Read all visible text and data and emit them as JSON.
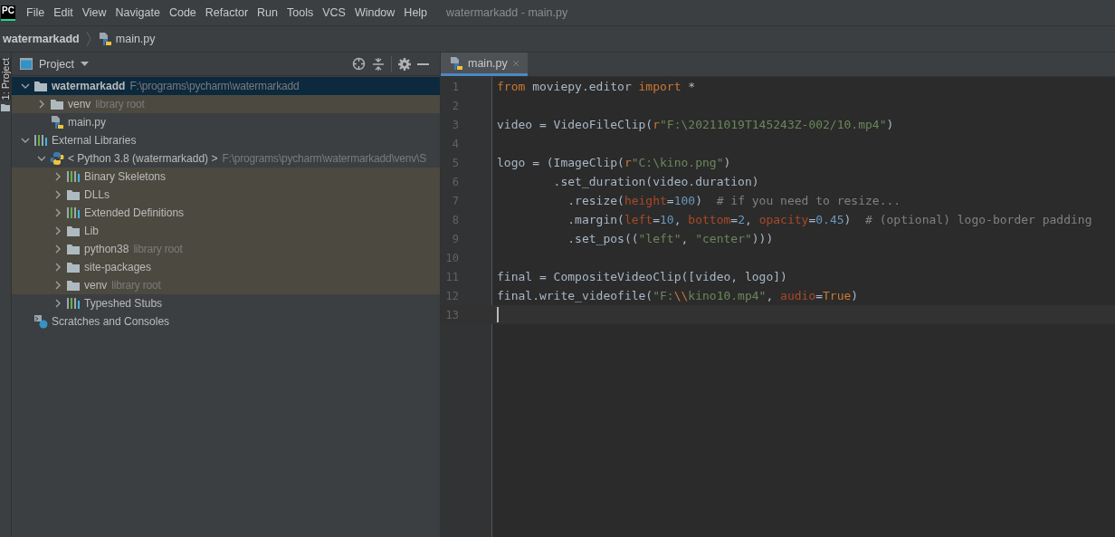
{
  "menu_bar": {
    "app_logo": "PC",
    "menu": [
      "File",
      "Edit",
      "View",
      "Navigate",
      "Code",
      "Refactor",
      "Run",
      "Tools",
      "VCS",
      "Window",
      "Help"
    ],
    "window_title": "watermarkadd - main.py"
  },
  "breadcrumb": [
    {
      "label": "watermarkadd",
      "kind": "project"
    },
    {
      "label": "main.py",
      "kind": "python_file"
    }
  ],
  "side_stripe": {
    "label": "1: Project"
  },
  "project_panel": {
    "title": "Project",
    "tree": [
      {
        "label": "watermarkadd",
        "kind": "project_folder",
        "hint": "F:\\programs\\pycharm\\watermarkadd",
        "expanded": true,
        "selected": true,
        "highlighted": false,
        "children": [
          {
            "label": "venv",
            "kind": "folder",
            "hint": "library root",
            "expanded": false,
            "selected": false,
            "highlighted": true
          },
          {
            "label": "main.py",
            "kind": "python_file",
            "selected": false,
            "highlighted": false
          }
        ]
      },
      {
        "label": "External Libraries",
        "kind": "library",
        "expanded": true,
        "selected": false,
        "highlighted": false,
        "children": [
          {
            "label": "< Python 3.8 (watermarkadd) >",
            "kind": "python",
            "hint": "F:\\programs\\pycharm\\watermarkadd\\venv\\S",
            "expanded": true,
            "selected": false,
            "highlighted": false,
            "children": [
              {
                "label": "Binary Skeletons",
                "kind": "library",
                "expanded": false,
                "selected": false,
                "highlighted": true
              },
              {
                "label": "DLLs",
                "kind": "folder",
                "expanded": false,
                "selected": false,
                "highlighted": true
              },
              {
                "label": "Extended Definitions",
                "kind": "library",
                "expanded": false,
                "selected": false,
                "highlighted": true
              },
              {
                "label": "Lib",
                "kind": "folder",
                "expanded": false,
                "selected": false,
                "highlighted": true
              },
              {
                "label": "python38",
                "kind": "folder",
                "hint": "library root",
                "expanded": false,
                "selected": false,
                "highlighted": true
              },
              {
                "label": "site-packages",
                "kind": "folder",
                "expanded": false,
                "selected": false,
                "highlighted": true
              },
              {
                "label": "venv",
                "kind": "folder",
                "hint": "library root",
                "expanded": false,
                "selected": false,
                "highlighted": true
              },
              {
                "label": "Typeshed Stubs",
                "kind": "library",
                "expanded": false,
                "selected": false,
                "highlighted": false
              }
            ]
          }
        ]
      },
      {
        "label": "Scratches and Consoles",
        "kind": "scratches",
        "selected": false,
        "highlighted": false
      }
    ]
  },
  "editor": {
    "tabs": [
      {
        "label": "main.py",
        "selected": true
      }
    ],
    "lines": [
      {
        "number": "1",
        "current": false,
        "tokens": [
          {
            "t": "from",
            "kind": "kw"
          },
          {
            "t": " moviepy.editor ",
            "kind": "text"
          },
          {
            "t": "import",
            "kind": "kw"
          },
          {
            "t": " *",
            "kind": "text"
          }
        ]
      },
      {
        "number": "2",
        "current": false
      },
      {
        "number": "3",
        "current": false,
        "tokens": [
          {
            "t": "video = VideoFileClip(",
            "kind": "text"
          },
          {
            "t": "r",
            "kind": "kw"
          },
          {
            "t": "\"F:\\20211019T145243Z-002/10.mp4\"",
            "kind": "str"
          },
          {
            "t": ")",
            "kind": "text"
          }
        ]
      },
      {
        "number": "4",
        "current": false
      },
      {
        "number": "5",
        "current": false,
        "tokens": [
          {
            "t": "logo = (ImageClip(",
            "kind": "text"
          },
          {
            "t": "r",
            "kind": "kw"
          },
          {
            "t": "\"C:\\kino.png\"",
            "kind": "str"
          },
          {
            "t": ")",
            "kind": "text"
          }
        ]
      },
      {
        "number": "6",
        "current": false,
        "tokens": [
          {
            "t": "        .set_duration(video.duration)",
            "kind": "text"
          }
        ]
      },
      {
        "number": "7",
        "current": false,
        "tokens": [
          {
            "t": "          .resize(",
            "kind": "text"
          },
          {
            "t": "height",
            "kind": "param"
          },
          {
            "t": "=",
            "kind": "text"
          },
          {
            "t": "100",
            "kind": "num"
          },
          {
            "t": ")  ",
            "kind": "text"
          },
          {
            "t": "# if you need to resize...",
            "kind": "comment"
          }
        ]
      },
      {
        "number": "8",
        "current": false,
        "tokens": [
          {
            "t": "          .margin(",
            "kind": "text"
          },
          {
            "t": "left",
            "kind": "param"
          },
          {
            "t": "=",
            "kind": "text"
          },
          {
            "t": "10",
            "kind": "num"
          },
          {
            "t": ", ",
            "kind": "text"
          },
          {
            "t": "bottom",
            "kind": "param"
          },
          {
            "t": "=",
            "kind": "text"
          },
          {
            "t": "2",
            "kind": "num"
          },
          {
            "t": ", ",
            "kind": "text"
          },
          {
            "t": "opacity",
            "kind": "param"
          },
          {
            "t": "=",
            "kind": "text"
          },
          {
            "t": "0.45",
            "kind": "num"
          },
          {
            "t": ")  ",
            "kind": "text"
          },
          {
            "t": "# (optional) logo-border padding",
            "kind": "comment"
          }
        ]
      },
      {
        "number": "9",
        "current": false,
        "tokens": [
          {
            "t": "          .set_pos((",
            "kind": "text"
          },
          {
            "t": "\"left\"",
            "kind": "str"
          },
          {
            "t": ", ",
            "kind": "text"
          },
          {
            "t": "\"center\"",
            "kind": "str"
          },
          {
            "t": ")))",
            "kind": "text"
          }
        ]
      },
      {
        "number": "10",
        "current": false
      },
      {
        "number": "11",
        "current": false,
        "tokens": [
          {
            "t": "final = CompositeVideoClip([video, logo])",
            "kind": "text"
          }
        ]
      },
      {
        "number": "12",
        "current": false,
        "tokens": [
          {
            "t": "final.write_videofile(",
            "kind": "text"
          },
          {
            "t": "\"F:",
            "kind": "str"
          },
          {
            "t": "\\\\",
            "kind": "kw"
          },
          {
            "t": "kino10.mp4\"",
            "kind": "str"
          },
          {
            "t": ", ",
            "kind": "text"
          },
          {
            "t": "audio",
            "kind": "param"
          },
          {
            "t": "=",
            "kind": "text"
          },
          {
            "t": "True",
            "kind": "kw"
          },
          {
            "t": ")",
            "kind": "text"
          }
        ]
      },
      {
        "number": "13",
        "current": true
      }
    ]
  }
}
